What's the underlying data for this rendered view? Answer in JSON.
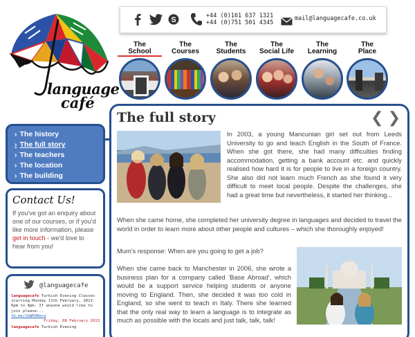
{
  "logo": {
    "line1": "language",
    "line2": "café"
  },
  "contact": {
    "phone1": "+44 (0)161 637 1321",
    "phone2": "+44 (0)751 501 4345",
    "email": "mail@languagecafe.co.uk"
  },
  "social_icons": [
    "facebook-icon",
    "twitter-icon",
    "skype-icon"
  ],
  "nav": [
    {
      "line1": "The",
      "line2": "School"
    },
    {
      "line1": "The",
      "line2": "Courses"
    },
    {
      "line1": "The",
      "line2": "Students"
    },
    {
      "line1": "The",
      "line2": "Social Life"
    },
    {
      "line1": "The",
      "line2": "Learning"
    },
    {
      "line1": "The",
      "line2": "Place"
    }
  ],
  "main": {
    "title": "The full story",
    "p1": "In 2003, a young Mancunian girl set out from Leeds University to go and teach English in the South of France. When she got there, she had many difficulties finding accommodation, getting a bank account etc. and quickly realised how hard it is for people to live in a foreign country. She also did not learn much French as she found it very difficult to meet local people. Despite the challenges, she had a great time but nevertheless, it started her thinking...",
    "p2": "When she came home, she completed her university degree in languages and decided to travel the world in order to learn more about other people and cultures – which she thoroughly enjoyed!",
    "p3": "Mum's response: When are you going to get a job?",
    "p4": "When she came back to Manchester in 2006, she wrote a business plan for a company called 'Base Abroad', which would be a support service helping students or anyone moving to England. Then, she decided it was too cold in England, so she went to teach in Italy. There she learned that the only real way to learn a language is to integrate as much as possible with the locals and just talk, talk, talk!"
  },
  "subnav": [
    {
      "label": "The history"
    },
    {
      "label": "The full story"
    },
    {
      "label": "The teachers"
    },
    {
      "label": "The location"
    },
    {
      "label": "The building"
    }
  ],
  "contact_box": {
    "title": "Contact Us!",
    "text_before": "If you've got an enquiry about one of our courses, or if you'd like more information, please ",
    "link": "get in touch",
    "text_after": " - we'd love to hear from you!"
  },
  "twitter": {
    "handle": "@languagecafe",
    "tweets": [
      {
        "user": "languagecafe",
        "text": "Turkish Evening Classes starting Monday 11th February, 2013. 6pm to 8pm. If anyone would like to join please...",
        "link": "fb.me/1bWH9Hmrq",
        "date": "Friday, 08 February 2013"
      },
      {
        "user": "languagecafe",
        "text": "Turkish Evening",
        "link": "",
        "date": ""
      }
    ]
  }
}
